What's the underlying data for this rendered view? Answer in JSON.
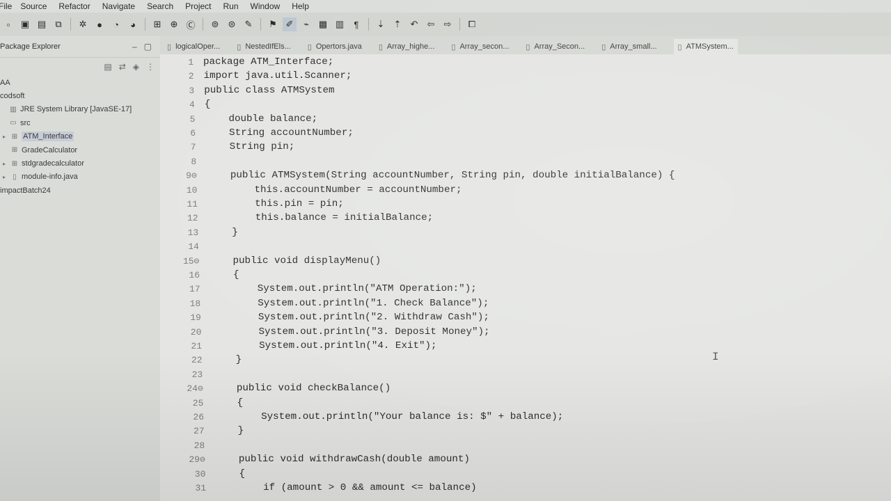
{
  "menu": [
    "File",
    "Source",
    "Refactor",
    "Navigate",
    "Search",
    "Project",
    "Run",
    "Window",
    "Help"
  ],
  "explorer": {
    "title": "Package Explorer",
    "items": [
      {
        "label": "AA",
        "indent": 0,
        "icon": "project-icon",
        "arrow": ""
      },
      {
        "label": "codsoft",
        "indent": 0,
        "icon": "project-icon",
        "arrow": ""
      },
      {
        "label": "JRE System Library [JavaSE-17]",
        "indent": 1,
        "icon": "library-icon",
        "arrow": ""
      },
      {
        "label": "src",
        "indent": 1,
        "icon": "folder-icon",
        "arrow": ""
      },
      {
        "label": "ATM_Interface",
        "indent": 2,
        "icon": "package-icon",
        "arrow": "▸",
        "selected": true
      },
      {
        "label": "GradeCalculator",
        "indent": 2,
        "icon": "package-icon",
        "arrow": ""
      },
      {
        "label": "stdgradecalculator",
        "indent": 2,
        "icon": "package-icon",
        "arrow": "▸"
      },
      {
        "label": "module-info.java",
        "indent": 2,
        "icon": "file-icon",
        "arrow": "▸"
      },
      {
        "label": "impactBatch24",
        "indent": 0,
        "icon": "project-icon",
        "arrow": ""
      }
    ]
  },
  "tabs": [
    {
      "label": "logicalOper...",
      "active": false
    },
    {
      "label": "NestedIfEls...",
      "active": false
    },
    {
      "label": "Opertors.java",
      "active": false
    },
    {
      "label": "Array_highe...",
      "active": false
    },
    {
      "label": "Array_secon...",
      "active": false
    },
    {
      "label": "Array_Secon...",
      "active": false
    },
    {
      "label": "Array_small...",
      "active": false
    },
    {
      "label": "ATMSystem...",
      "active": true
    }
  ],
  "code": [
    {
      "n": "1",
      "t": "package ATM_Interface;"
    },
    {
      "n": "2",
      "t": "import java.util.Scanner;"
    },
    {
      "n": "3",
      "t": "public class ATMSystem"
    },
    {
      "n": "4",
      "t": "{"
    },
    {
      "n": "5",
      "t": "    double balance;"
    },
    {
      "n": "6",
      "t": "    String accountNumber;"
    },
    {
      "n": "7",
      "t": "    String pin;"
    },
    {
      "n": "8",
      "t": ""
    },
    {
      "n": "9⊖",
      "t": "    public ATMSystem(String accountNumber, String pin, double initialBalance) {"
    },
    {
      "n": "10",
      "t": "        this.accountNumber = accountNumber;"
    },
    {
      "n": "11",
      "t": "        this.pin = pin;"
    },
    {
      "n": "12",
      "t": "        this.balance = initialBalance;"
    },
    {
      "n": "13",
      "t": "    }"
    },
    {
      "n": "14",
      "t": ""
    },
    {
      "n": "15⊖",
      "t": "    public void displayMenu()"
    },
    {
      "n": "16",
      "t": "    {"
    },
    {
      "n": "17",
      "t": "        System.out.println(\"ATM Operation:\");"
    },
    {
      "n": "18",
      "t": "        System.out.println(\"1. Check Balance\");"
    },
    {
      "n": "19",
      "t": "        System.out.println(\"2. Withdraw Cash\");"
    },
    {
      "n": "20",
      "t": "        System.out.println(\"3. Deposit Money\");"
    },
    {
      "n": "21",
      "t": "        System.out.println(\"4. Exit\");"
    },
    {
      "n": "22",
      "t": "    }"
    },
    {
      "n": "23",
      "t": ""
    },
    {
      "n": "24⊖",
      "t": "    public void checkBalance()"
    },
    {
      "n": "25",
      "t": "    {"
    },
    {
      "n": "26",
      "t": "        System.out.println(\"Your balance is: $\" + balance);"
    },
    {
      "n": "27",
      "t": "    }"
    },
    {
      "n": "28",
      "t": ""
    },
    {
      "n": "29⊖",
      "t": "    public void withdrawCash(double amount)"
    },
    {
      "n": "30",
      "t": "    {"
    },
    {
      "n": "31",
      "t": "        if (amount > 0 && amount <= balance)"
    }
  ]
}
